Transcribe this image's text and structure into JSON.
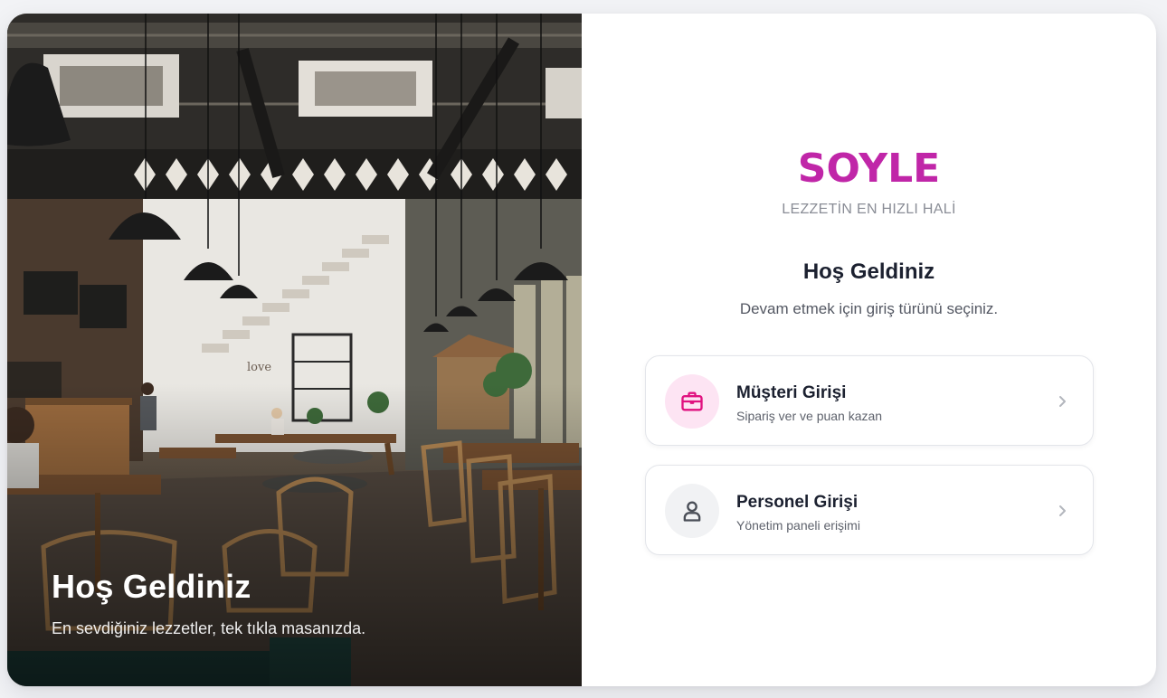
{
  "hero": {
    "title": "Hoş Geldiniz",
    "subtitle": "En sevdiğiniz lezzetler, tek tıkla masanızda.",
    "wall_text": "love",
    "icon": "restaurant-interior-photo"
  },
  "login": {
    "brand": "SOYLE",
    "tagline": "LEZZETİN EN HIZLI HALİ",
    "welcome": "Hoş Geldiniz",
    "instruction": "Devam etmek için giriş türünü seçiniz.",
    "options": [
      {
        "title": "Müşteri Girişi",
        "description": "Sipariş ver ve puan kazan",
        "icon": "briefcase-icon",
        "chevron_icon": "chevron-right-icon"
      },
      {
        "title": "Personel Girişi",
        "description": "Yönetim paneli erişimi",
        "icon": "user-icon",
        "chevron_icon": "chevron-right-icon"
      }
    ]
  },
  "colors": {
    "brand": "#c026a8",
    "customer_icon_bg": "#fde4f3",
    "customer_icon": "#e0117f",
    "staff_icon_bg": "#f1f2f4",
    "staff_icon": "#4a4e57",
    "page_bg": "#f2f3f6"
  }
}
